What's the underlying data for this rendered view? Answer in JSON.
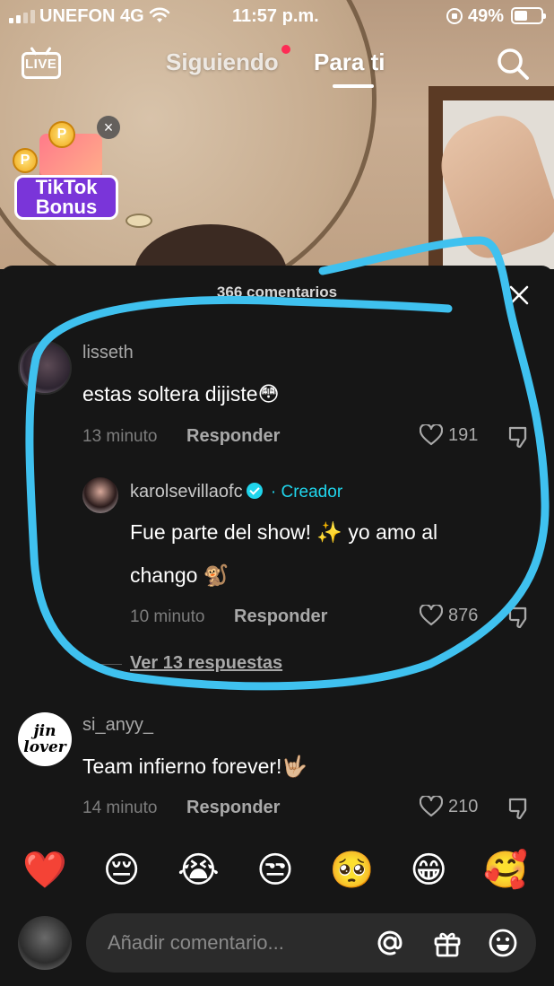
{
  "status_bar": {
    "carrier": "UNEFON 4G",
    "time": "11:57 p.m.",
    "battery": "49%",
    "battery_level": 0.49
  },
  "top_nav": {
    "live_label": "LIVE",
    "tabs": [
      {
        "label": "Siguiendo",
        "active": false,
        "has_dot": true
      },
      {
        "label": "Para ti",
        "active": true
      }
    ]
  },
  "bonus": {
    "line1": "TikTok",
    "line2": "Bonus",
    "coin_symbol": "P"
  },
  "comments_sheet": {
    "title": "366 comentarios",
    "comments": [
      {
        "username": "lisseth",
        "text": "estas soltera dijiste😳",
        "time": "13 minuto",
        "reply_label": "Responder",
        "likes": "191",
        "replies": [
          {
            "username": "karolsevillaofc",
            "badge": "Creador",
            "text_line1": "Fue parte del show! ✨ yo amo al",
            "text_line2": "chango 🐒",
            "time": "10 minuto",
            "reply_label": "Responder",
            "likes": "876"
          }
        ],
        "view_replies": "Ver 13 respuestas"
      },
      {
        "username": "si_anyy_",
        "avatar_text": [
          "jin",
          "lover"
        ],
        "text": "Team infierno forever!🤟🏼",
        "time": "14 minuto",
        "reply_label": "Responder",
        "likes": "210"
      }
    ],
    "quick_emojis": [
      "❤️",
      "😔",
      "😭",
      "😒",
      "🥺",
      "😁",
      "🥰"
    ],
    "input_placeholder": "Añadir comentario..."
  },
  "colors": {
    "accent_red": "#fe2c55",
    "creator_cyan": "#20d5ec",
    "highlight_blue": "#3fc1ef",
    "sheet_bg": "#161616"
  }
}
